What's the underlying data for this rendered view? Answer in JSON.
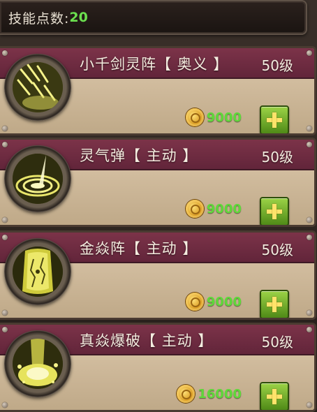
{
  "points": {
    "label": "技能点数:",
    "value": "20"
  },
  "skills": [
    {
      "name": "小千剑灵阵【 奥义 】",
      "level": "50级",
      "cost": "9000",
      "icon": "sword-rain-icon"
    },
    {
      "name": "灵气弹【 主动 】",
      "level": "50级",
      "cost": "9000",
      "icon": "spirit-orb-icon"
    },
    {
      "name": "金焱阵【 主动 】",
      "level": "50级",
      "cost": "9000",
      "icon": "golden-flame-pillar-icon"
    },
    {
      "name": "真焱爆破【 主动 】",
      "level": "50级",
      "cost": "16000",
      "icon": "flame-blast-icon"
    }
  ],
  "colors": {
    "accent_green": "#6be04f",
    "header_maroon": "#7c3349",
    "cost_green": "#5fd83a"
  }
}
